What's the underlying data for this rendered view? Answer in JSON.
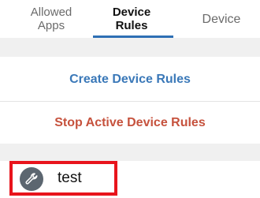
{
  "tabs": [
    {
      "label_line1": "Allowed",
      "label_line2": "Apps",
      "active": false
    },
    {
      "label_line1": "Device",
      "label_line2": "Rules",
      "active": true
    },
    {
      "label_line1": "Device",
      "label_line2": "",
      "active": false
    }
  ],
  "actions": {
    "create_label": "Create Device Rules",
    "stop_label": "Stop Active Device Rules"
  },
  "rules": [
    {
      "name": "test",
      "icon": "wrench-icon",
      "highlighted": true
    }
  ],
  "colors": {
    "accent": "#2d6fb4",
    "create": "#3a78b8",
    "stop": "#c6523d",
    "highlight": "#e8141c",
    "icon_bg": "#5c6670"
  }
}
